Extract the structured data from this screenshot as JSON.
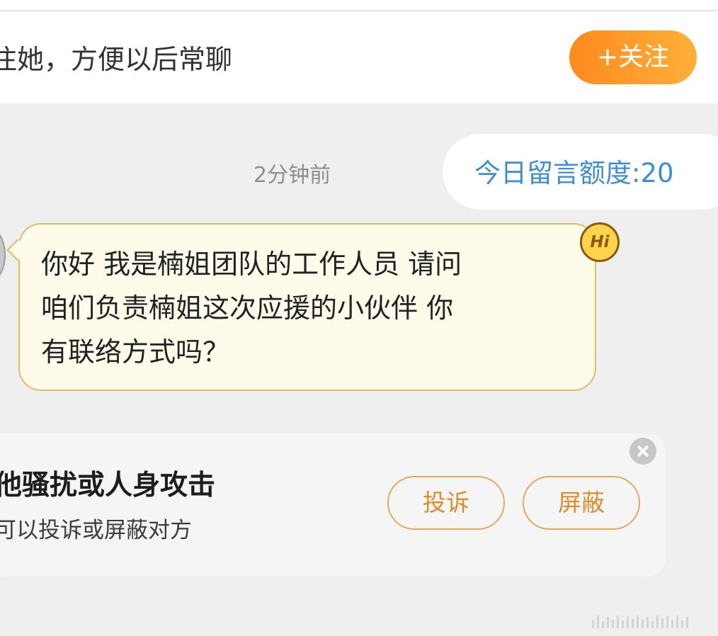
{
  "header": {
    "follow_hint": "注她，方便以后常聊",
    "follow_button": "+关注",
    "accent_color": "#ff9d2e"
  },
  "chat": {
    "timestamp": "2分钟前",
    "quota_text": "今日留言额度:20",
    "message_text": "你好 我是楠姐团队的工作人员 请问\n咱们负责楠姐这次应援的小伙伴 你\n有联络方式吗？",
    "badge_text": "Hi",
    "bubble_border": "#e2ba69",
    "bubble_background": "#fffbeb"
  },
  "report": {
    "title": "他骚扰或人身攻击",
    "subtitle": "可以投诉或屏蔽对方",
    "complain_label": "投诉",
    "block_label": "屏蔽",
    "button_color": "#de8d2b"
  },
  "icons": {
    "close": "close-icon",
    "badge": "hi-badge-icon",
    "avatar": "avatar"
  }
}
